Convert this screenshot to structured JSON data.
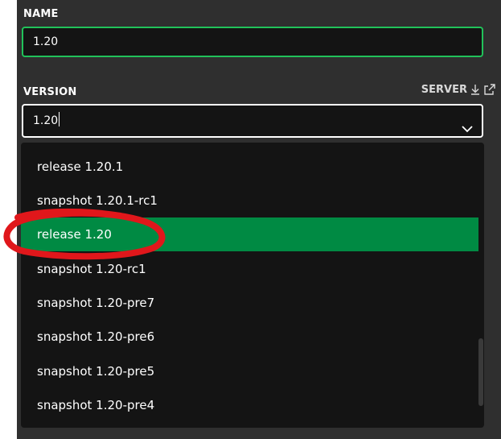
{
  "form": {
    "name_label": "NAME",
    "name_value": "1.20",
    "version_label": "VERSION",
    "server_label": "SERVER",
    "server_icons": [
      "download-icon",
      "external-link-icon"
    ],
    "version_value": "1.20"
  },
  "dropdown": {
    "options": [
      {
        "label": "release 1.20.1"
      },
      {
        "label": "snapshot 1.20.1-rc1"
      },
      {
        "label": "release 1.20"
      },
      {
        "label": "snapshot 1.20-rc1"
      },
      {
        "label": "snapshot 1.20-pre7"
      },
      {
        "label": "snapshot 1.20-pre6"
      },
      {
        "label": "snapshot 1.20-pre5"
      },
      {
        "label": "snapshot 1.20-pre4"
      }
    ],
    "selected_index": 2
  },
  "colors": {
    "panel_bg": "#2f2f2f",
    "field_bg": "#141414",
    "name_border": "#21c25a",
    "selected_bg": "#008a43",
    "annotation": "#e0171b"
  }
}
